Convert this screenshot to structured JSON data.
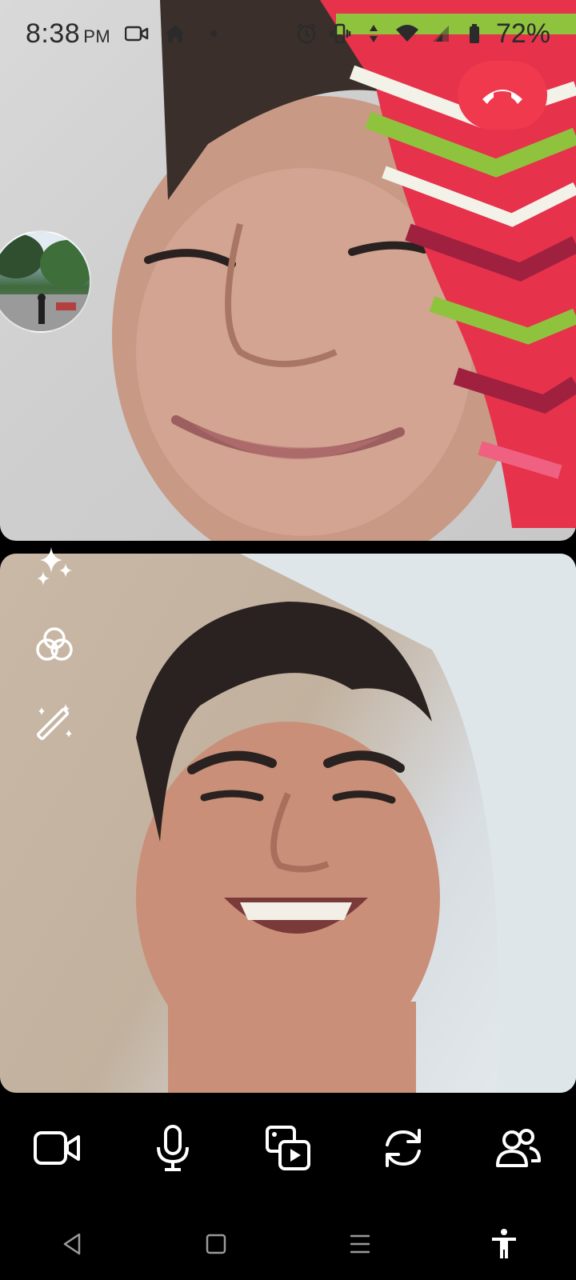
{
  "status_bar": {
    "time": "8:38",
    "ampm": "PM",
    "battery": "72%",
    "icons": [
      "video-camera-icon",
      "home-icon",
      "dot-icon",
      "alarm-icon",
      "vibrate-icon",
      "data-arrows-icon",
      "wifi-icon",
      "signal-icon",
      "battery-icon"
    ]
  },
  "call": {
    "end_call_icon": "end-call-icon",
    "end_call_color": "#f0394c"
  },
  "effects": [
    "sparkles-icon",
    "filters-icon",
    "magic-wand-icon"
  ],
  "controls": [
    "video-camera-icon",
    "microphone-icon",
    "media-share-icon",
    "flip-camera-icon",
    "people-icon"
  ],
  "nav": [
    "back-icon",
    "home-icon",
    "recents-icon",
    "accessibility-icon"
  ]
}
